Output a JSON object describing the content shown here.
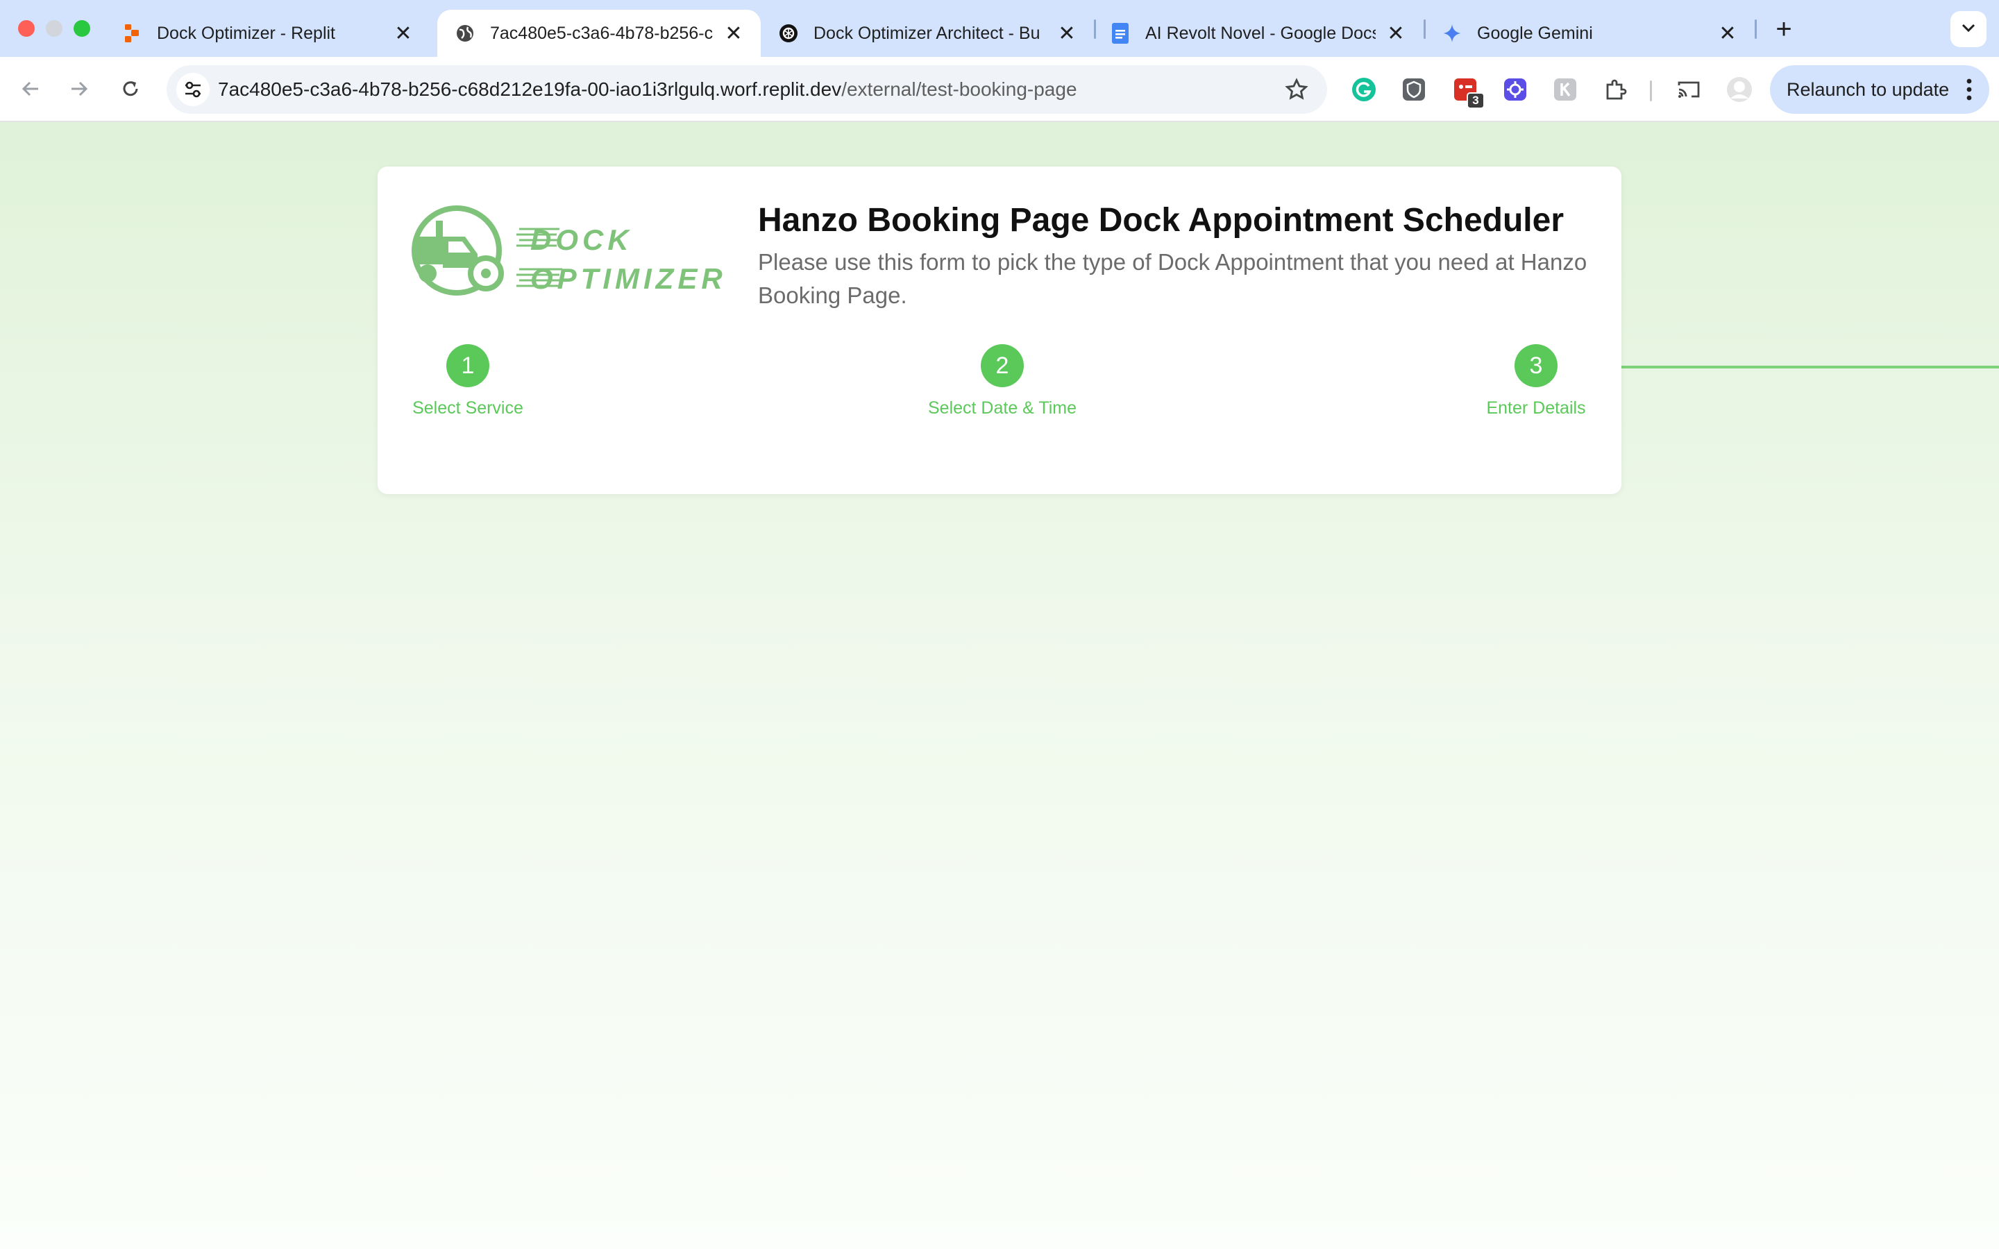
{
  "browser": {
    "tabs": [
      {
        "title": "Dock Optimizer - Replit",
        "favicon": "replit-icon",
        "active": false
      },
      {
        "title": "7ac480e5-c3a6-4b78-b256-c",
        "favicon": "globe-icon",
        "active": true
      },
      {
        "title": "Dock Optimizer Architect - Bu",
        "favicon": "chatgpt-icon",
        "active": false
      },
      {
        "title": "AI Revolt Novel - Google Docs",
        "favicon": "google-docs-icon",
        "active": false
      },
      {
        "title": "Google Gemini",
        "favicon": "gemini-icon",
        "active": false
      }
    ],
    "tab_close_glyph": "✕",
    "new_tab_glyph": "+",
    "url": {
      "host": "7ac480e5-c3a6-4b78-b256-c68d212e19fa-00-iao1i3rlgulq.worf.replit.dev",
      "path": "/external/test-booking-page"
    },
    "extensions": [
      {
        "name": "grammarly-icon"
      },
      {
        "name": "extension-shield-icon"
      },
      {
        "name": "extension-badge-icon",
        "badge": "3"
      },
      {
        "name": "extension-gear-icon"
      },
      {
        "name": "extension-k-icon"
      },
      {
        "name": "extensions-puzzle-icon"
      }
    ],
    "relaunch_label": "Relaunch to update",
    "colors": {
      "tabstrip": "#d3e3fd",
      "accent": "#5bc95a"
    }
  },
  "page": {
    "logo": {
      "line1": "DOCK",
      "line2": "OPTIMIZER"
    },
    "title": "Hanzo Booking Page Dock Appointment Scheduler",
    "subtitle": "Please use this form to pick the type of Dock Appointment that you need at Hanzo Booking Page.",
    "steps": [
      {
        "number": "1",
        "label": "Select Service"
      },
      {
        "number": "2",
        "label": "Select Date & Time"
      },
      {
        "number": "3",
        "label": "Enter Details"
      }
    ]
  }
}
